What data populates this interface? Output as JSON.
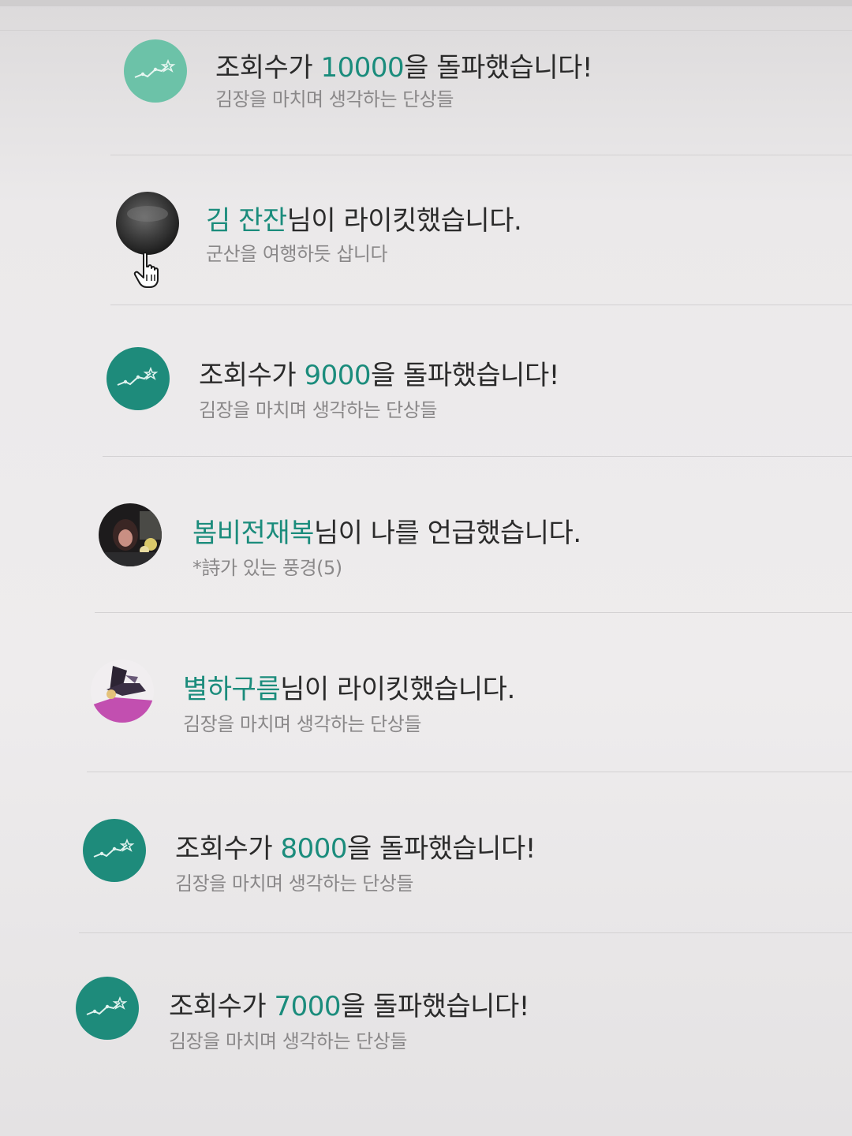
{
  "notifications": [
    {
      "type": "views",
      "prefix": "조회수가 ",
      "highlight": "10000",
      "suffix": "을 돌파했습니다!",
      "subtitle": "김장을 마치며 생각하는 단상들",
      "avatar_icon": "chart-line-icon",
      "avatar_color": "#6cc2a8"
    },
    {
      "type": "like",
      "prefix": "",
      "highlight": "김 잔잔",
      "suffix": "님이 라이킷했습니다.",
      "subtitle": "군산을 여행하듯 삽니다",
      "avatar_icon": "user-avatar",
      "avatar_color": "#3d3d3d"
    },
    {
      "type": "views",
      "prefix": "조회수가 ",
      "highlight": "9000",
      "suffix": "을 돌파했습니다!",
      "subtitle": "김장을 마치며 생각하는 단상들",
      "avatar_icon": "chart-line-icon",
      "avatar_color": "#1e8b7b"
    },
    {
      "type": "mention",
      "prefix": "",
      "highlight": "봄비전재복",
      "suffix": "님이 나를 언급했습니다.",
      "subtitle": "*詩가 있는 풍경(5)",
      "avatar_icon": "user-avatar",
      "avatar_color": "#2a2a2a"
    },
    {
      "type": "like",
      "prefix": "",
      "highlight": "별하구름",
      "suffix": "님이 라이킷했습니다.",
      "subtitle": "김장을 마치며 생각하는 단상들",
      "avatar_icon": "user-avatar",
      "avatar_color": "#c24fb0"
    },
    {
      "type": "views",
      "prefix": "조회수가 ",
      "highlight": "8000",
      "suffix": "을 돌파했습니다!",
      "subtitle": "김장을 마치며 생각하는 단상들",
      "avatar_icon": "chart-line-icon",
      "avatar_color": "#1e8b7b"
    },
    {
      "type": "views",
      "prefix": "조회수가 ",
      "highlight": "7000",
      "suffix": "을 돌파했습니다!",
      "subtitle": "김장을 마치며 생각하는 단상들",
      "avatar_icon": "chart-line-icon",
      "avatar_color": "#1e8b7b"
    }
  ],
  "colors": {
    "highlight": "#1b8c7c",
    "title_text": "#2b2b2b",
    "subtitle_text": "#8a8889"
  }
}
